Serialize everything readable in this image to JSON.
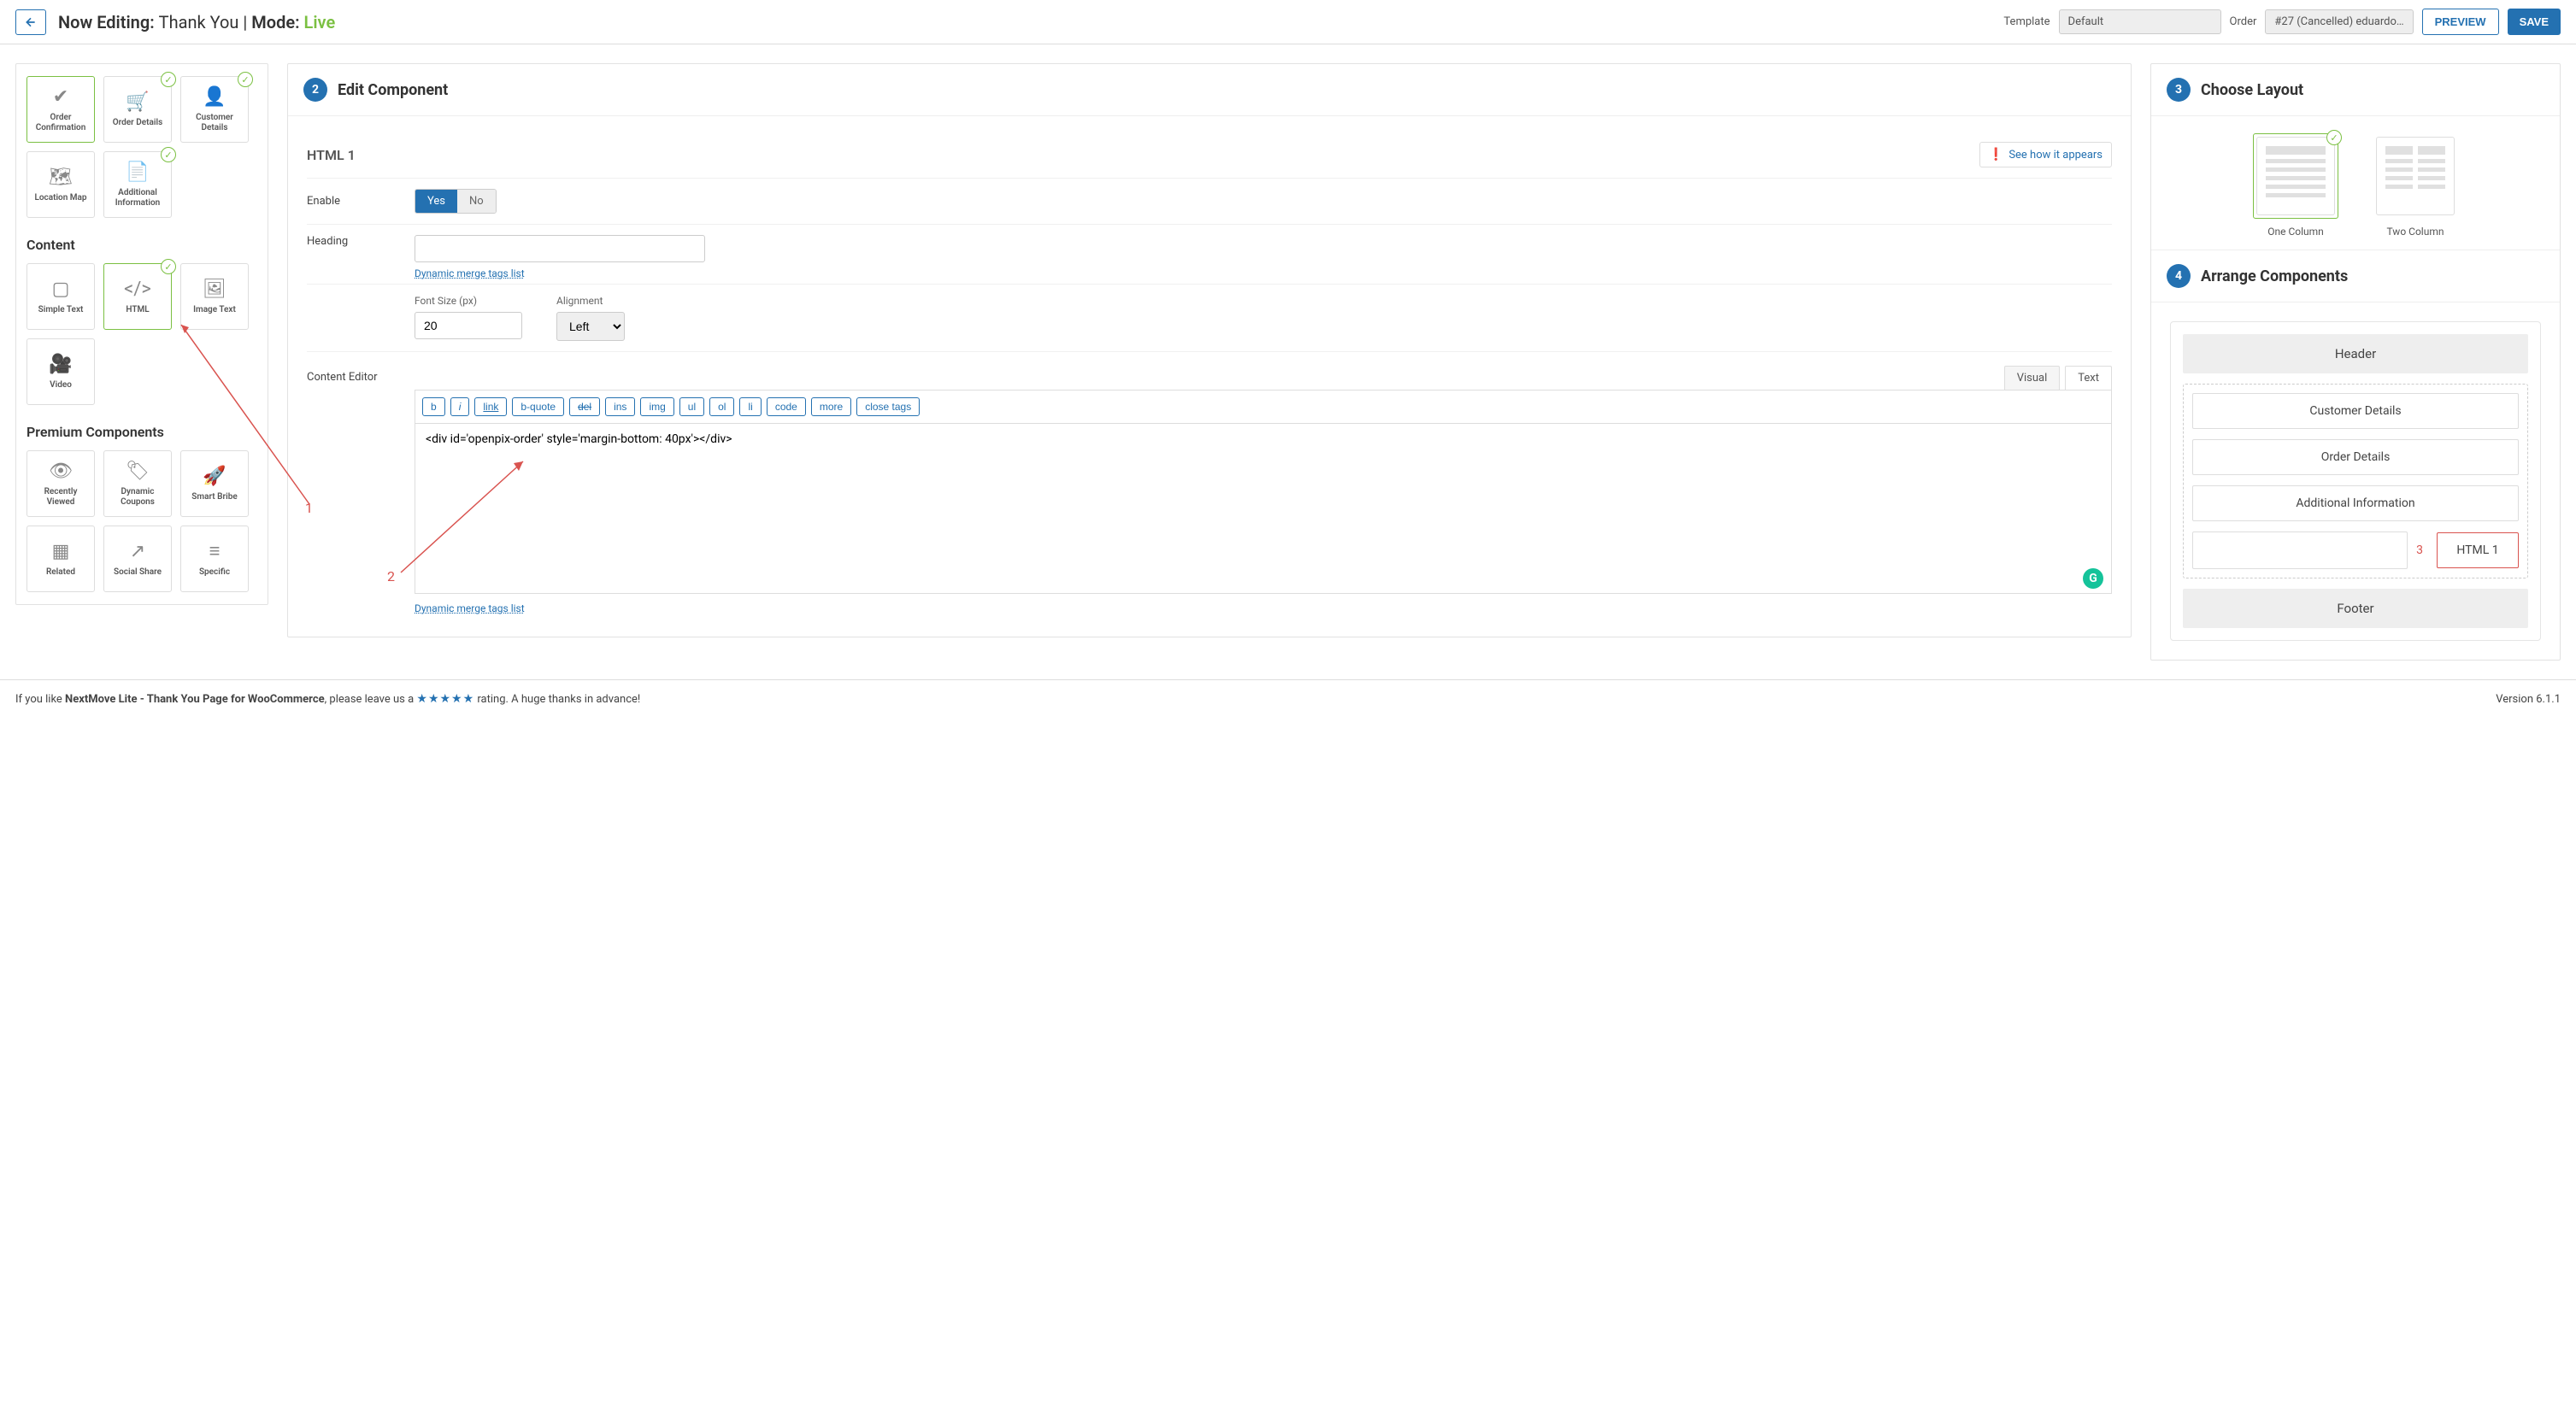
{
  "topbar": {
    "editing_prefix": "Now Editing:",
    "editing_name": "Thank You",
    "mode_prefix": "Mode:",
    "mode_value": "Live",
    "template_label": "Template",
    "template_value": "Default",
    "order_label": "Order",
    "order_value": "#27 (Cancelled) eduardo…",
    "preview": "PREVIEW",
    "save": "SAVE"
  },
  "sidebar": {
    "tiles_top": [
      {
        "label": "Order Confirmation",
        "icon": "✔",
        "selected": true,
        "checked": false
      },
      {
        "label": "Order Details",
        "icon": "🛒",
        "selected": false,
        "checked": true
      },
      {
        "label": "Customer Details",
        "icon": "👤",
        "selected": false,
        "checked": true
      },
      {
        "label": "Location Map",
        "icon": "🗺",
        "selected": false,
        "checked": false
      },
      {
        "label": "Additional Information",
        "icon": "📄",
        "selected": false,
        "checked": true
      }
    ],
    "content_heading": "Content",
    "tiles_content": [
      {
        "label": "Simple Text",
        "icon": "▢",
        "selected": false,
        "checked": false
      },
      {
        "label": "HTML",
        "icon": "</>",
        "selected": true,
        "checked": true
      },
      {
        "label": "Image Text",
        "icon": "🖼",
        "selected": false,
        "checked": false
      },
      {
        "label": "Video",
        "icon": "🎥",
        "selected": false,
        "checked": false
      }
    ],
    "premium_heading": "Premium Components",
    "tiles_premium": [
      {
        "label": "Recently Viewed",
        "icon": "👁"
      },
      {
        "label": "Dynamic Coupons",
        "icon": "🏷"
      },
      {
        "label": "Smart Bribe",
        "icon": "🚀"
      },
      {
        "label": "Related",
        "icon": "▦"
      },
      {
        "label": "Social Share",
        "icon": "↗"
      },
      {
        "label": "Specific",
        "icon": "≡"
      }
    ]
  },
  "edit": {
    "step": "2",
    "title": "Edit Component",
    "component_name": "HTML 1",
    "see_how": "See how it appears",
    "enable_label": "Enable",
    "yes": "Yes",
    "no": "No",
    "heading_label": "Heading",
    "heading_value": "",
    "merge_link": "Dynamic merge tags list",
    "font_size_label": "Font Size (px)",
    "font_size_value": "20",
    "alignment_label": "Alignment",
    "alignment_value": "Left",
    "content_editor_label": "Content Editor",
    "tab_visual": "Visual",
    "tab_text": "Text",
    "toolbar": [
      "b",
      "i",
      "link",
      "b-quote",
      "del",
      "ins",
      "img",
      "ul",
      "ol",
      "li",
      "code",
      "more",
      "close tags"
    ],
    "editor_content": "<div id='openpix-order' style='margin-bottom: 40px'></div>"
  },
  "layout": {
    "step": "3",
    "title": "Choose Layout",
    "one_col": "One Column",
    "two_col": "Two Column"
  },
  "arrange": {
    "step": "4",
    "title": "Arrange Components",
    "header": "Header",
    "items": [
      "Customer Details",
      "Order Details",
      "Additional Information"
    ],
    "html1": "HTML 1",
    "footer": "Footer",
    "anno3": "3"
  },
  "annotations": {
    "n1": "1",
    "n2": "2"
  },
  "footer": {
    "text1": "If you like ",
    "bold": "NextMove Lite - Thank You Page for WooCommerce",
    "text2": ", please leave us a ",
    "stars": "★★★★★",
    "text3": " rating. A huge thanks in advance!",
    "version": "Version 6.1.1"
  }
}
